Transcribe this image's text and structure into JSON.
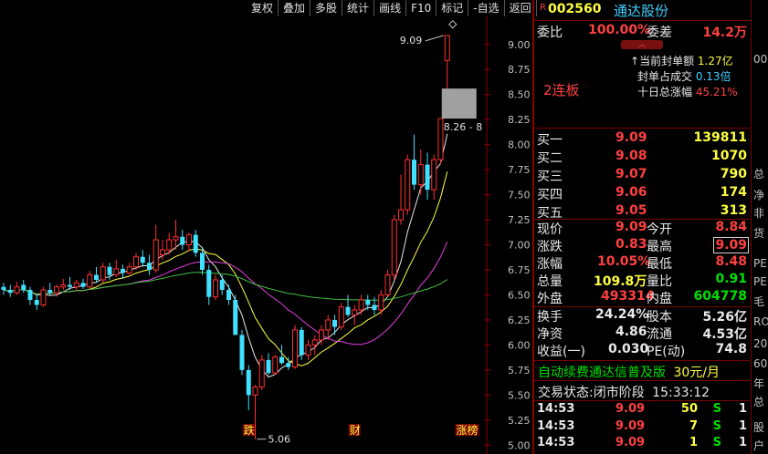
{
  "toolbar": {
    "items": [
      "复权",
      "叠加",
      "多股",
      "统计",
      "画线",
      "F10",
      "标记",
      "-自选",
      "返回"
    ]
  },
  "stock": {
    "code_prefix": "R",
    "code": "002560",
    "name": "通达股份"
  },
  "weibi": {
    "label1": "委比",
    "value1": "100.00%",
    "label2": "委差",
    "value2": "14.2万"
  },
  "limit_info": {
    "streak": "2连板",
    "seal_amount_label": "当前封单额",
    "seal_amount": "1.27亿",
    "seal_ratio_label": "封单占成交",
    "seal_ratio": "0.13倍",
    "ten_day_label": "十日总涨幅",
    "ten_day": "45.21%"
  },
  "bids": [
    {
      "label": "买一",
      "price": "9.09",
      "vol": "139811"
    },
    {
      "label": "买二",
      "price": "9.08",
      "vol": "1070"
    },
    {
      "label": "买三",
      "price": "9.07",
      "vol": "790"
    },
    {
      "label": "买四",
      "price": "9.06",
      "vol": "174"
    },
    {
      "label": "买五",
      "price": "9.05",
      "vol": "313"
    }
  ],
  "quote": [
    {
      "l1": "现价",
      "v1": "9.09",
      "l2": "今开",
      "v2": "8.84"
    },
    {
      "l1": "涨跌",
      "v1": "0.83",
      "l2": "最高",
      "v2": "9.09"
    },
    {
      "l1": "涨幅",
      "v1": "10.05%",
      "l2": "最低",
      "v2": "8.48"
    },
    {
      "l1": "总量",
      "v1": "109.8万",
      "l2": "量比",
      "v2": "0.91"
    },
    {
      "l1": "外盘",
      "v1": "493314",
      "l2": "内盘",
      "v2": "604778"
    }
  ],
  "fund": [
    {
      "l1": "换手",
      "v1": "24.24%",
      "l2": "股本",
      "v2": "5.26亿"
    },
    {
      "l1": "净资",
      "v1": "4.86",
      "l2": "流通",
      "v2": "4.53亿"
    },
    {
      "l1": "收益(一)",
      "v1": "0.030",
      "l2": "PE(动)",
      "v2": "74.8"
    }
  ],
  "ad": {
    "text": "自动续费通达信普及版",
    "price": "30元/月"
  },
  "status": {
    "label": "交易状态:",
    "value": "闭市阶段",
    "time": "15:33:12"
  },
  "trades": [
    {
      "time": "14:53",
      "price": "9.09",
      "vol": "50",
      "side": "S",
      "n": "1"
    },
    {
      "time": "14:53",
      "price": "9.09",
      "vol": "7",
      "side": "S",
      "n": "1"
    },
    {
      "time": "14:53",
      "price": "9.09",
      "vol": "1",
      "side": "S",
      "n": "1"
    }
  ],
  "right_edge": {
    "items": [
      "00",
      "总",
      "净",
      "非",
      "货",
      "PE",
      "PE",
      "毛",
      "RO",
      "20",
      "60",
      "年",
      "总",
      "股",
      "户"
    ]
  },
  "chart_data": {
    "type": "candlestick",
    "ylim": [
      4.93,
      9.28
    ],
    "yticks": [
      "9.00",
      "8.75",
      "8.50",
      "8.25",
      "8.00",
      "7.75",
      "7.50",
      "7.25",
      "7.00",
      "6.75",
      "6.50",
      "6.25",
      "6.00",
      "5.75",
      "5.50",
      "5.25",
      "5.00"
    ],
    "annotations": {
      "high": "9.09",
      "low": "5.06",
      "cursor_label": "8.26 - 8"
    },
    "markers": [
      {
        "text": "跌",
        "day": 37
      },
      {
        "text": "财",
        "day": 53
      },
      {
        "text": "涨榜",
        "day": 70
      }
    ],
    "ohlc": [
      [
        6.58,
        6.62,
        6.5,
        6.55
      ],
      [
        6.55,
        6.6,
        6.48,
        6.52
      ],
      [
        6.52,
        6.63,
        6.5,
        6.58
      ],
      [
        6.6,
        6.65,
        6.52,
        6.55
      ],
      [
        6.55,
        6.58,
        6.4,
        6.45
      ],
      [
        6.45,
        6.5,
        6.35,
        6.4
      ],
      [
        6.4,
        6.58,
        6.38,
        6.55
      ],
      [
        6.55,
        6.62,
        6.5,
        6.52
      ],
      [
        6.52,
        6.6,
        6.48,
        6.58
      ],
      [
        6.58,
        6.66,
        6.55,
        6.6
      ],
      [
        6.6,
        6.68,
        6.55,
        6.58
      ],
      [
        6.58,
        6.65,
        6.54,
        6.62
      ],
      [
        6.62,
        6.66,
        6.56,
        6.58
      ],
      [
        6.58,
        6.74,
        6.56,
        6.7
      ],
      [
        6.7,
        6.78,
        6.62,
        6.65
      ],
      [
        6.65,
        6.82,
        6.62,
        6.78
      ],
      [
        6.78,
        6.82,
        6.65,
        6.7
      ],
      [
        6.7,
        6.85,
        6.68,
        6.76
      ],
      [
        6.76,
        6.8,
        6.66,
        6.72
      ],
      [
        6.72,
        6.82,
        6.7,
        6.78
      ],
      [
        6.78,
        6.92,
        6.75,
        6.88
      ],
      [
        6.88,
        6.95,
        6.78,
        6.82
      ],
      [
        6.82,
        6.9,
        6.7,
        6.75
      ],
      [
        6.75,
        7.2,
        6.72,
        7.05
      ],
      [
        6.9,
        7.05,
        6.85,
        6.95
      ],
      [
        6.95,
        7.12,
        6.9,
        7.05
      ],
      [
        7.05,
        7.25,
        6.95,
        7.08
      ],
      [
        7.08,
        7.15,
        6.95,
        7.0
      ],
      [
        7.0,
        7.12,
        6.94,
        7.1
      ],
      [
        7.1,
        7.15,
        6.88,
        6.92
      ],
      [
        6.92,
        6.98,
        6.7,
        6.75
      ],
      [
        6.75,
        6.8,
        6.4,
        6.48
      ],
      [
        6.48,
        6.7,
        6.45,
        6.65
      ],
      [
        6.65,
        6.7,
        6.5,
        6.55
      ],
      [
        6.55,
        6.6,
        6.4,
        6.45
      ],
      [
        6.45,
        6.5,
        6.1,
        6.1
      ],
      [
        6.1,
        6.15,
        5.7,
        5.75
      ],
      [
        5.75,
        5.8,
        5.35,
        5.5
      ],
      [
        5.5,
        5.6,
        5.06,
        5.58
      ],
      [
        5.58,
        5.9,
        5.55,
        5.85
      ],
      [
        5.85,
        5.92,
        5.7,
        5.72
      ],
      [
        5.72,
        5.9,
        5.7,
        5.88
      ],
      [
        5.88,
        6.0,
        5.8,
        5.82
      ],
      [
        5.82,
        5.88,
        5.75,
        5.78
      ],
      [
        5.78,
        6.2,
        5.76,
        6.15
      ],
      [
        6.15,
        6.18,
        5.85,
        5.9
      ],
      [
        5.9,
        6.05,
        5.85,
        6.0
      ],
      [
        6.0,
        6.1,
        5.9,
        6.05
      ],
      [
        6.05,
        6.2,
        6.0,
        6.15
      ],
      [
        6.15,
        6.3,
        6.05,
        6.25
      ],
      [
        6.25,
        6.3,
        6.1,
        6.18
      ],
      [
        6.18,
        6.42,
        6.15,
        6.38
      ],
      [
        6.38,
        6.5,
        6.28,
        6.3
      ],
      [
        6.3,
        6.4,
        6.2,
        6.35
      ],
      [
        6.35,
        6.5,
        6.3,
        6.45
      ],
      [
        6.45,
        6.5,
        6.35,
        6.4
      ],
      [
        6.4,
        6.48,
        6.3,
        6.35
      ],
      [
        6.35,
        6.55,
        6.3,
        6.5
      ],
      [
        6.5,
        6.75,
        6.48,
        6.7
      ],
      [
        6.7,
        7.3,
        6.65,
        7.25
      ],
      [
        7.25,
        7.7,
        7.2,
        7.35
      ],
      [
        7.35,
        7.9,
        7.3,
        7.85
      ],
      [
        7.85,
        8.1,
        7.55,
        7.6
      ],
      [
        7.6,
        7.95,
        7.5,
        7.8
      ],
      [
        7.8,
        7.92,
        7.45,
        7.55
      ],
      [
        7.55,
        7.9,
        7.45,
        7.85
      ],
      [
        7.85,
        8.26,
        7.8,
        8.26
      ],
      [
        8.84,
        9.09,
        8.48,
        9.09
      ]
    ]
  }
}
